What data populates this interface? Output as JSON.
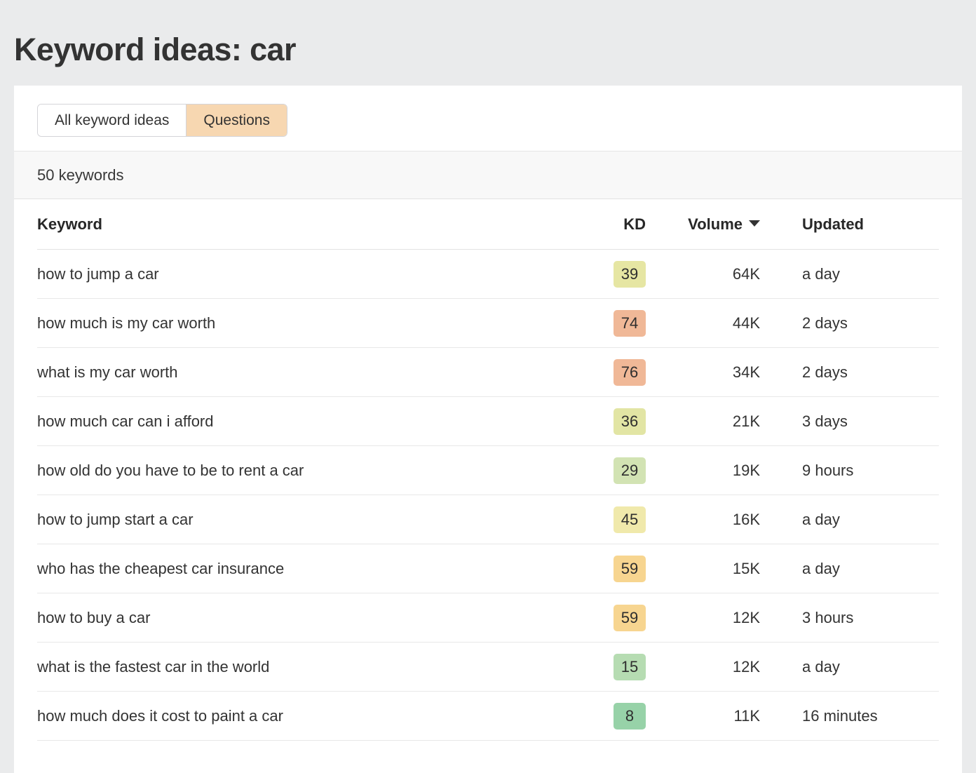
{
  "page": {
    "title": "Keyword ideas: car",
    "background_color": "#eaebec"
  },
  "tabs": [
    {
      "label": "All keyword ideas",
      "active": false
    },
    {
      "label": "Questions",
      "active": true,
      "active_color": "#f7d7b1"
    }
  ],
  "summary": {
    "count_label": "50 keywords"
  },
  "table": {
    "columns": [
      {
        "key": "keyword",
        "label": "Keyword",
        "sorted": false
      },
      {
        "key": "kd",
        "label": "KD",
        "sorted": false
      },
      {
        "key": "volume",
        "label": "Volume",
        "sorted": true,
        "sort_direction": "desc"
      },
      {
        "key": "updated",
        "label": "Updated",
        "sorted": false
      }
    ],
    "rows": [
      {
        "keyword": "how to jump a car",
        "kd": "39",
        "kd_color": "#e6e6a3",
        "volume": "64K",
        "updated": "a day"
      },
      {
        "keyword": "how much is my car worth",
        "kd": "74",
        "kd_color": "#f0b897",
        "volume": "44K",
        "updated": "2 days"
      },
      {
        "keyword": "what is my car worth",
        "kd": "76",
        "kd_color": "#f0b897",
        "volume": "34K",
        "updated": "2 days"
      },
      {
        "keyword": "how much car can i afford",
        "kd": "36",
        "kd_color": "#e2e5a4",
        "volume": "21K",
        "updated": "3 days"
      },
      {
        "keyword": "how old do you have to be to rent a car",
        "kd": "29",
        "kd_color": "#d2e3b3",
        "volume": "19K",
        "updated": "9 hours"
      },
      {
        "keyword": "how to jump start a car",
        "kd": "45",
        "kd_color": "#f0e9ab",
        "volume": "16K",
        "updated": "a day"
      },
      {
        "keyword": "who has the cheapest car insurance",
        "kd": "59",
        "kd_color": "#f7d590",
        "volume": "15K",
        "updated": "a day"
      },
      {
        "keyword": "how to buy a car",
        "kd": "59",
        "kd_color": "#f7d590",
        "volume": "12K",
        "updated": "3 hours"
      },
      {
        "keyword": "what is the fastest car in the world",
        "kd": "15",
        "kd_color": "#b6dcb2",
        "volume": "12K",
        "updated": "a day"
      },
      {
        "keyword": "how much does it cost to paint a car",
        "kd": "8",
        "kd_color": "#97d2a8",
        "volume": "11K",
        "updated": "16 minutes"
      }
    ]
  }
}
